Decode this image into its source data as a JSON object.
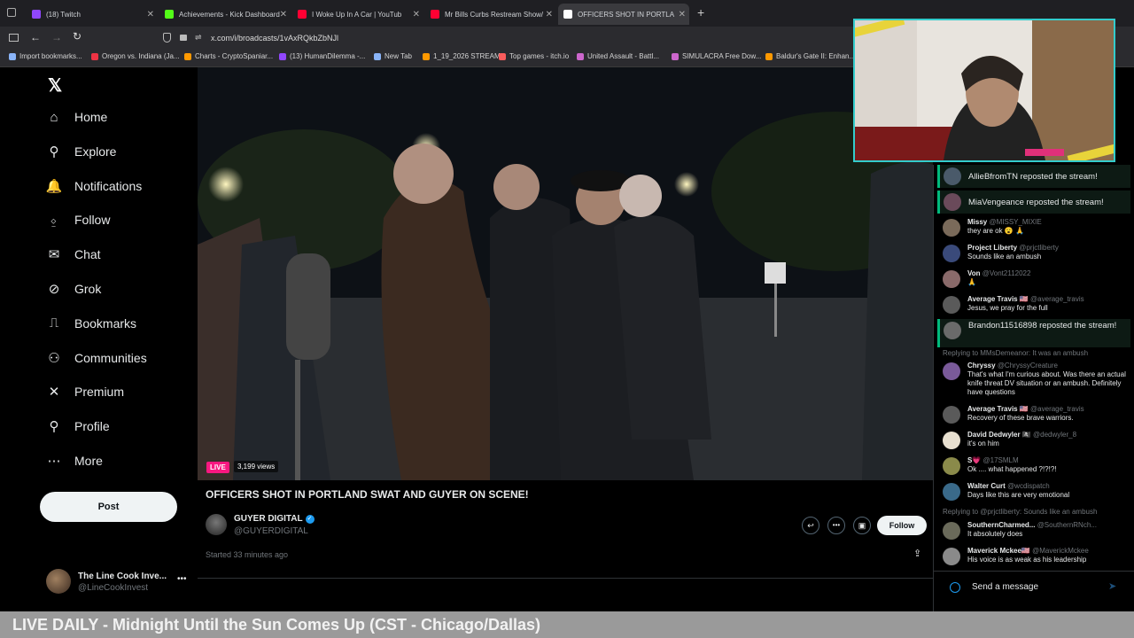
{
  "browser": {
    "tabs": [
      {
        "label": "(18) Twitch",
        "color": "#9147ff"
      },
      {
        "label": "Achievements - Kick Dashboard",
        "color": "#53fc18"
      },
      {
        "label": "I Woke Up In A Car | YouTub",
        "color": "#ff0033"
      },
      {
        "label": "Mr Bills Curbs Restream Show/",
        "color": "#ff0033"
      },
      {
        "label": "OFFICERS SHOT IN PORTLA",
        "color": "#ffffff"
      }
    ],
    "url": "x.com/i/broadcasts/1vAxRQkbZbNJl",
    "bookmarks": [
      {
        "label": "Import bookmarks...",
        "color": "#8ab4f8"
      },
      {
        "label": "Oregon vs. Indiana (Ja...",
        "color": "#e34"
      },
      {
        "label": "Charts - CryptoSpaniar...",
        "color": "#f90"
      },
      {
        "label": "(13) HumanDilemma -...",
        "color": "#9147ff"
      },
      {
        "label": "New Tab",
        "color": "#8ab4f8"
      },
      {
        "label": "1_19_2026 STREAM",
        "color": "#f90"
      },
      {
        "label": "Top games - itch.io",
        "color": "#fa5c5c"
      },
      {
        "label": "United Assault - Battl...",
        "color": "#c6c"
      },
      {
        "label": "SIMULACRA Free Dow...",
        "color": "#c6c"
      },
      {
        "label": "Baldur's Gate II: Enhan...",
        "color": "#f90"
      }
    ]
  },
  "sidebar": {
    "items": [
      {
        "label": "Home",
        "icon": "home-icon"
      },
      {
        "label": "Explore",
        "icon": "search-icon"
      },
      {
        "label": "Notifications",
        "icon": "bell-icon"
      },
      {
        "label": "Follow",
        "icon": "add-user-icon"
      },
      {
        "label": "Chat",
        "icon": "mail-icon"
      },
      {
        "label": "Grok",
        "icon": "grok-icon"
      },
      {
        "label": "Bookmarks",
        "icon": "bookmark-icon"
      },
      {
        "label": "Communities",
        "icon": "people-icon"
      },
      {
        "label": "Premium",
        "icon": "x-icon"
      },
      {
        "label": "Profile",
        "icon": "person-icon"
      },
      {
        "label": "More",
        "icon": "more-circle-icon"
      }
    ],
    "post_label": "Post",
    "account": {
      "name": "The Line Cook Inve...",
      "handle": "@LineCookInvest"
    }
  },
  "broadcast": {
    "live_badge": "LIVE",
    "views": "3,199 views",
    "title": "OFFICERS SHOT IN PORTLAND SWAT AND GUYER ON SCENE!",
    "channel_name": "GUYER DIGITAL",
    "channel_handle": "@GUYERDIGITAL",
    "follow_label": "Follow",
    "started": "Started 33 minutes ago"
  },
  "chat": {
    "messages": [
      {
        "kind": "repost",
        "text": "AllieBfromTN reposted the stream!"
      },
      {
        "kind": "repost",
        "text": "MiaVengeance reposted the stream!"
      },
      {
        "kind": "msg",
        "name": "Missy",
        "handle": "@MISSY_MIXIE",
        "text": "they are ok 😮 🙏"
      },
      {
        "kind": "msg",
        "name": "Project Liberty",
        "handle": "@prjctliberty",
        "text": "Sounds like an ambush"
      },
      {
        "kind": "msg",
        "name": "Von",
        "handle": "@Vont2112022",
        "text": "🙏"
      },
      {
        "kind": "msg",
        "name": "Average Travis 🇺🇸",
        "handle": "@average_travis",
        "text": "Jesus, we pray for the full"
      },
      {
        "kind": "repost",
        "text": "Brandon11516898 reposted the stream!"
      },
      {
        "kind": "reply",
        "text": "Replying to MMsDemeanor: It was an ambush"
      },
      {
        "kind": "msg",
        "name": "Chryssy",
        "handle": "@ChryssyCreature",
        "text": "That's what I'm curious about. Was there an actual knife threat DV situation or an ambush. Definitely have questions"
      },
      {
        "kind": "msg",
        "name": "Average Travis 🇺🇸",
        "handle": "@average_travis",
        "text": "Recovery of these brave warriors."
      },
      {
        "kind": "msg",
        "name": "David Dedwyler 🏴‍☠️",
        "handle": "@dedwyler_8",
        "text": "it's on him"
      },
      {
        "kind": "msg",
        "name": "S💗",
        "handle": "@17SMLM",
        "text": "Ok .... what happened ?!?!?!"
      },
      {
        "kind": "msg",
        "name": "Walter Curt",
        "handle": "@wcdispatch",
        "text": "Days like this are very emotional"
      },
      {
        "kind": "reply",
        "text": "Replying to @prjctliberty: Sounds like an ambush"
      },
      {
        "kind": "msg",
        "name": "SouthernCharmed...",
        "handle": "@SouthernRNch...",
        "text": "It absolutely does"
      },
      {
        "kind": "msg",
        "name": "Maverick Mckee🇺🇸",
        "handle": "@MaverickMckee",
        "text": "His voice is as weak as his leadership"
      }
    ],
    "input_placeholder": "Send a message"
  },
  "overlay": {
    "ticker": "LIVE DAILY - Midnight Until the Sun Comes Up (CST - Chicago/Dallas)"
  },
  "colors": {
    "accent_green": "#00ba7c",
    "live_pink": "#f91880",
    "webcam_border": "#33cccc",
    "verified": "#1d9bf0"
  }
}
